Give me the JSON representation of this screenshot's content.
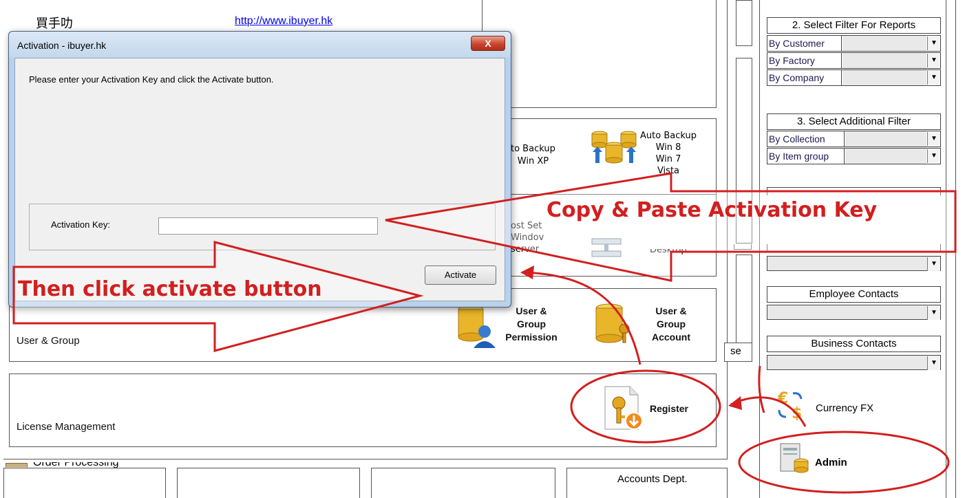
{
  "header": {
    "company_name": "買手叻",
    "website_link": "http://www.ibuyer.hk"
  },
  "tools": {
    "auto_backup_xp_label": "to Backup\nWin XP",
    "auto_backup_win8_label": "Auto Backup\nWin 8\nWin 7\nVista",
    "host_setup_label": "ost Set\nWindov\nserver",
    "desktop_label": "Desktop",
    "user_group_permission_label": "User &\nGroup\nPermission",
    "user_group_account_label": "User &\nGroup\nAccount",
    "user_group_section_label": "User & Group",
    "license_section_label": "License Management",
    "register_label": "Register",
    "order_processing_label": "Order Processing",
    "accounts_dept_label": "Accounts Dept.",
    "partial_se_label": "se"
  },
  "filters": {
    "report_filter_title": "2. Select Filter For Reports",
    "report_filters": [
      "By Customer",
      "By Factory",
      "By Company"
    ],
    "additional_filter_title": "3. Select Additional Filter",
    "additional_filters": [
      "By Collection",
      "By Item group"
    ],
    "employee_contacts_title": "Employee Contacts",
    "business_contacts_title": "Business Contacts",
    "currency_fx_label": "Currency FX",
    "admin_label": "Admin"
  },
  "dialog": {
    "title": "Activation - ibuyer.hk",
    "close_label": "X",
    "message": "Please enter your Activation Key and click the Activate button.",
    "key_label": "Activation Key:",
    "key_value": "",
    "activate_label": "Activate"
  },
  "annotations": {
    "copy_paste": "Copy & Paste Activation Key",
    "click_activate": "Then click activate button"
  },
  "colors": {
    "annotation_red": "#d21f1f",
    "dialog_frame": "#b9d1ea",
    "link_blue": "#0000ee"
  }
}
